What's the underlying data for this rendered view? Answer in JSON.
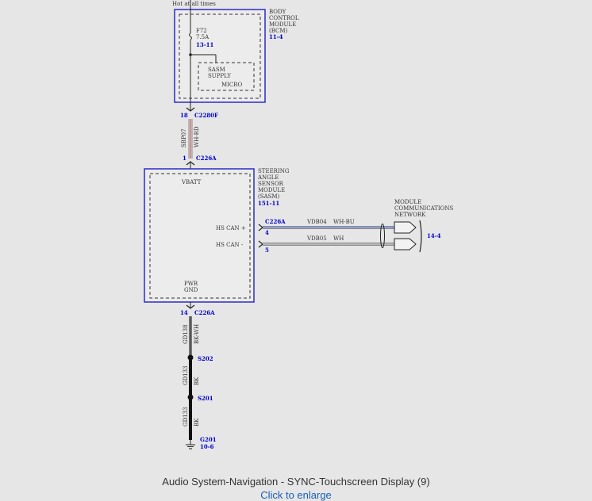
{
  "diagram": {
    "hot_label": "Hot at all times",
    "bcm": {
      "title_lines": [
        "BODY",
        "CONTROL",
        "MODULE",
        "(BCM)"
      ],
      "ref": "11-4",
      "fuse_name": "F72",
      "fuse_rating": "7.5A",
      "fuse_ref": "13-11",
      "supply_lines": [
        "SASM",
        "SUPPLY"
      ],
      "micro": "MICRO"
    },
    "conn_c2280f": {
      "pin": "18",
      "name": "C2280F"
    },
    "wire_sbp07": {
      "circuit": "SBP07",
      "color": "WH-RD"
    },
    "conn_c226a_top": {
      "pin": "1",
      "name": "C226A"
    },
    "sasm": {
      "title_lines": [
        "STEERING",
        "ANGLE",
        "SENSOR",
        "MODULE",
        "(SASM)"
      ],
      "ref": "151-11",
      "vbatt": "VBATT",
      "can_plus": "HS CAN +",
      "can_minus": "HS CAN -",
      "pwr_gnd_lines": [
        "PWR",
        "GND"
      ]
    },
    "can_conn": {
      "name": "C226A",
      "pin_plus": "4",
      "pin_minus": "5"
    },
    "wire_vdb04": {
      "circuit": "VDB04",
      "color": "WH-BU"
    },
    "wire_vdb05": {
      "circuit": "VDB05",
      "color": "WH"
    },
    "network": {
      "title_lines": [
        "MODULE",
        "COMMUNICATIONS",
        "NETWORK"
      ],
      "ref": "14-4"
    },
    "conn_c226a_bottom": {
      "pin": "14",
      "name": "C226A"
    },
    "wire_gd138": {
      "circuit": "GD138",
      "color": "BK-WH"
    },
    "splice_s202": "S202",
    "wire_gd133_a": {
      "circuit": "GD133",
      "color": "BK"
    },
    "splice_s201": "S201",
    "wire_gd133_b": {
      "circuit": "GD133",
      "color": "BK"
    },
    "ground": {
      "name": "G201",
      "ref": "10-6"
    }
  },
  "caption": "Audio System-Navigation - SYNC-Touchscreen Display (9)",
  "link": "Click to enlarge"
}
